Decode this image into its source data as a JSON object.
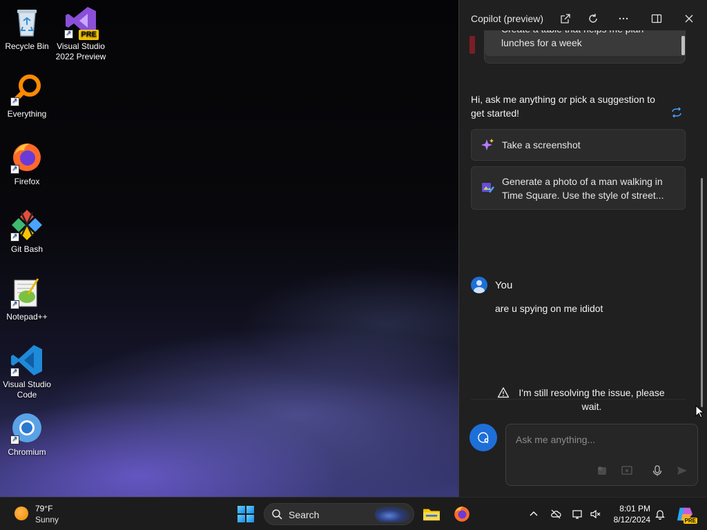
{
  "desktop": {
    "icons": [
      {
        "label": "Recycle Bin"
      },
      {
        "label": "Visual Studio 2022 Preview",
        "badge": "PRE"
      },
      {
        "label": "Everything"
      },
      {
        "label": "Firefox"
      },
      {
        "label": "Git Bash"
      },
      {
        "label": "Notepad++"
      },
      {
        "label": "Visual Studio Code"
      },
      {
        "label": "Chromium"
      }
    ]
  },
  "copilot": {
    "title": "Copilot (preview)",
    "header_icons": [
      "open-in-window-icon",
      "refresh-icon",
      "more-icon",
      "dock-panel-icon",
      "close-icon"
    ],
    "previous_suggestion": "Create a table that helps me plan lunches for a week",
    "greeting": "Hi, ask me anything or pick a suggestion to get started!",
    "suggestions": [
      {
        "text": "Take a screenshot",
        "icon": "sparkle-icon"
      },
      {
        "text": "Generate a photo of a man walking in Time Square. Use the style of street...",
        "icon": "image-edit-icon"
      }
    ],
    "user_name": "You",
    "user_message": "are u spying on me ididot",
    "status_message": "I'm still resolving the issue, please wait.",
    "input_placeholder": "Ask me anything...",
    "accent_color": "#1e6fd9"
  },
  "taskbar": {
    "weather": {
      "temp": "79°F",
      "condition": "Sunny"
    },
    "search_label": "Search",
    "clock": {
      "time": "8:01 PM",
      "date": "8/12/2024"
    },
    "copilot_badge": "PRE"
  }
}
